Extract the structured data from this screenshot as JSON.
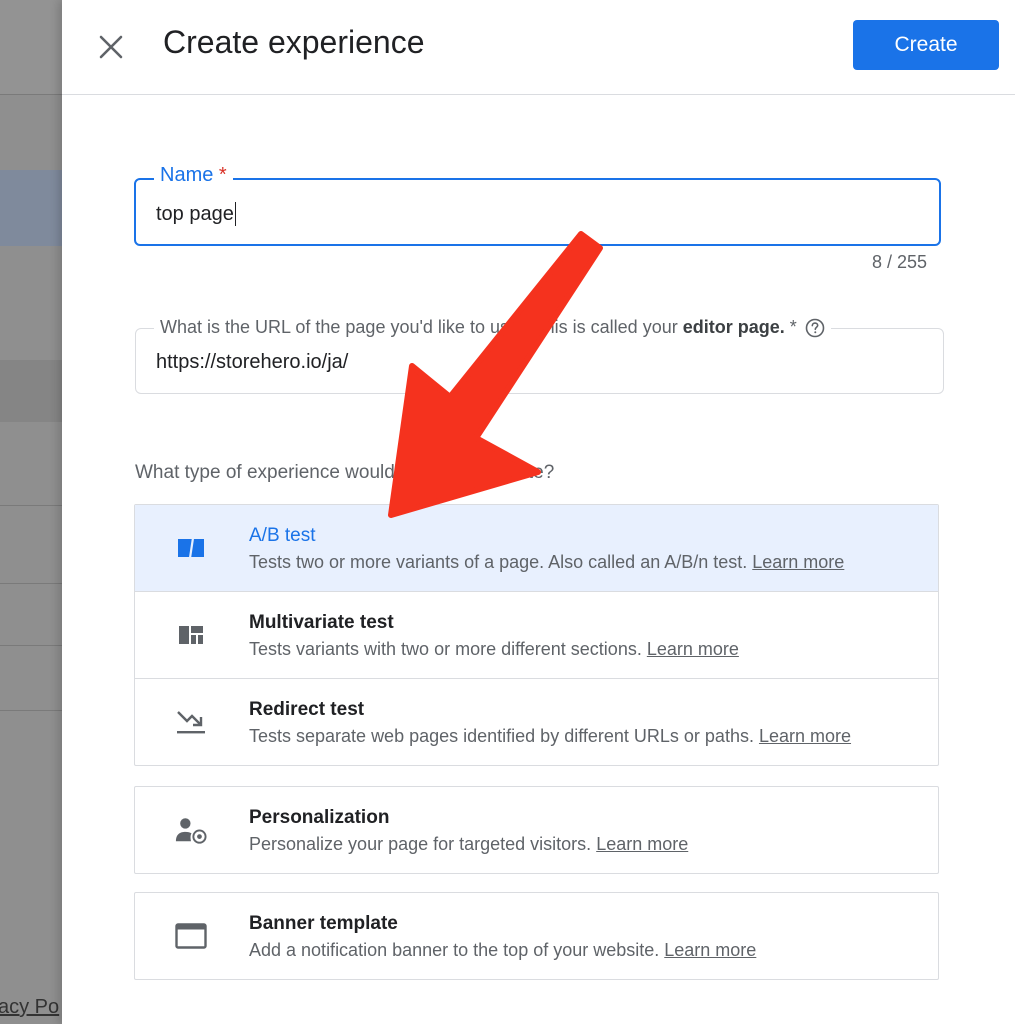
{
  "background": {
    "footer_text": "acy Po"
  },
  "header": {
    "title": "Create experience",
    "create_label": "Create"
  },
  "name_field": {
    "label": "Name",
    "required_mark": "*",
    "value": "top page",
    "counter": "8 / 255"
  },
  "url_field": {
    "label": "What is the URL of the page you'd like to use? This is called your",
    "label_bold": "editor page.",
    "required_mark": "*",
    "value": "https://storehero.io/ja/"
  },
  "question": "What type of experience would you like to create?",
  "experience_types": [
    {
      "title": "A/B test",
      "description": "Tests two or more variants of a page. Also called an A/B/n test.",
      "link": "Learn more",
      "icon": "ab-test-icon",
      "selected": true
    },
    {
      "title": "Multivariate test",
      "description": "Tests variants with two or more different sections.",
      "link": "Learn more",
      "icon": "multivariate-icon",
      "selected": false
    },
    {
      "title": "Redirect test",
      "description": "Tests separate web pages identified by different URLs or paths.",
      "link": "Learn more",
      "icon": "redirect-icon",
      "selected": false
    },
    {
      "title": "Personalization",
      "description": "Personalize your page for targeted visitors.",
      "link": "Learn more",
      "icon": "personalization-icon",
      "selected": false
    },
    {
      "title": "Banner template",
      "description": "Add a notification banner to the top of your website.",
      "link": "Learn more",
      "icon": "banner-icon",
      "selected": false
    }
  ],
  "colors": {
    "accent": "#1a73e8",
    "selected_bg": "#e8f0fe",
    "required": "#d93025",
    "annotation_arrow": "#f5321e"
  }
}
